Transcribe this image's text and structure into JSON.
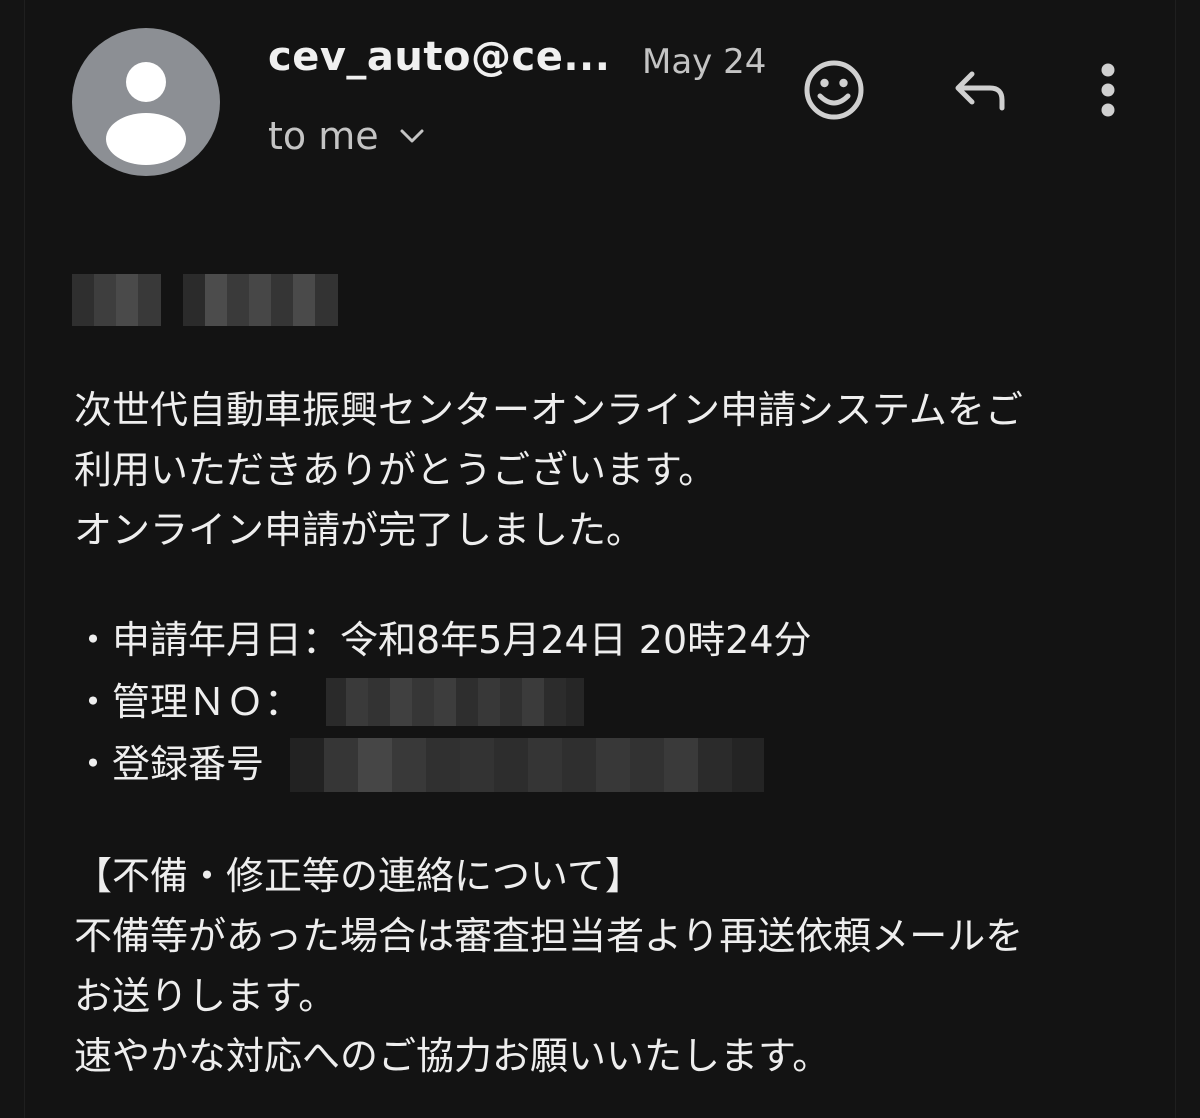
{
  "header": {
    "sender": "cev_auto@ce...",
    "date": "May 24",
    "recipient": "to me",
    "icons": {
      "avatar": "person-icon",
      "recipient_toggle": "chevron-down-icon",
      "react": "emoji-smile-icon",
      "reply": "reply-icon",
      "more": "more-vert-icon"
    }
  },
  "body": {
    "intro_lines": [
      "次世代自動車振興センターオンライン申請システムをご",
      "利用いただきありがとうございます。",
      "オンライン申請が完了しました。"
    ],
    "details": {
      "application_date": "・申請年月日：令和8年5月24日  20時24分",
      "management_no_label": "・管理ＮＯ：",
      "registration_no_label": "・登録番号"
    },
    "notice_heading": "【不備・修正等の連絡について】",
    "notice_lines": [
      "不備等があった場合は審査担当者より再送依頼メールを",
      "お送りします。",
      "速やかな対応へのご協力お願いいたします。"
    ]
  },
  "colors": {
    "background": "#131313",
    "avatar": "#8c8f94",
    "text": "#eeeeee",
    "muted": "#c4c4c4"
  }
}
